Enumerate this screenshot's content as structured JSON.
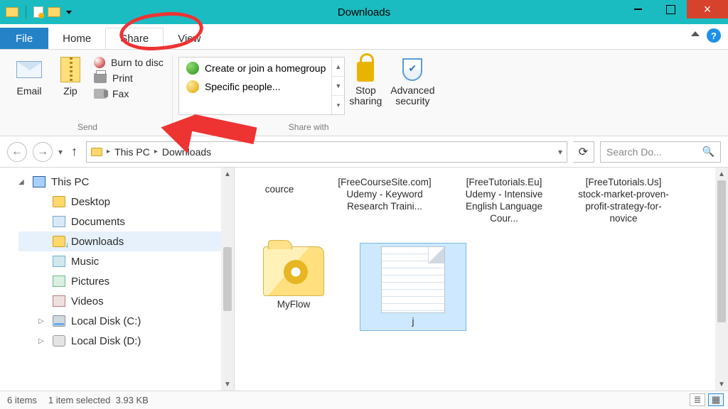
{
  "window": {
    "title": "Downloads"
  },
  "tabs": {
    "file": "File",
    "home": "Home",
    "share": "Share",
    "view": "View",
    "active": "share"
  },
  "ribbon": {
    "send": {
      "label": "Send",
      "email": "Email",
      "zip": "Zip",
      "burn": "Burn to disc",
      "print": "Print",
      "fax": "Fax"
    },
    "share_with": {
      "label": "Share with",
      "homegroup": "Create or join a homegroup",
      "specific": "Specific people...",
      "stop": "Stop sharing",
      "advanced": "Advanced security"
    }
  },
  "breadcrumb": {
    "root": "This PC",
    "current": "Downloads"
  },
  "search": {
    "placeholder": "Search Do..."
  },
  "tree": {
    "root": "This PC",
    "items": [
      {
        "label": "Desktop"
      },
      {
        "label": "Documents"
      },
      {
        "label": "Downloads",
        "selected": true
      },
      {
        "label": "Music"
      },
      {
        "label": "Pictures"
      },
      {
        "label": "Videos"
      },
      {
        "label": "Local Disk (C:)"
      },
      {
        "label": "Local Disk (D:)"
      }
    ]
  },
  "items": [
    {
      "name": "cource",
      "kind": "folder"
    },
    {
      "name": "[FreeCourseSite.com] Udemy - Keyword Research Traini...",
      "kind": "folder"
    },
    {
      "name": "[FreeTutorials.Eu] Udemy - Intensive English Language Cour...",
      "kind": "folder"
    },
    {
      "name": "[FreeTutorials.Us] stock-market-proven-profit-strategy-for-novice",
      "kind": "folder"
    },
    {
      "name": "MyFlow",
      "kind": "folder-open"
    },
    {
      "name": "j",
      "kind": "note",
      "selected": true
    }
  ],
  "status": {
    "count": "6 items",
    "selection": "1 item selected",
    "size": "3.93 KB"
  },
  "help_glyph": "?"
}
